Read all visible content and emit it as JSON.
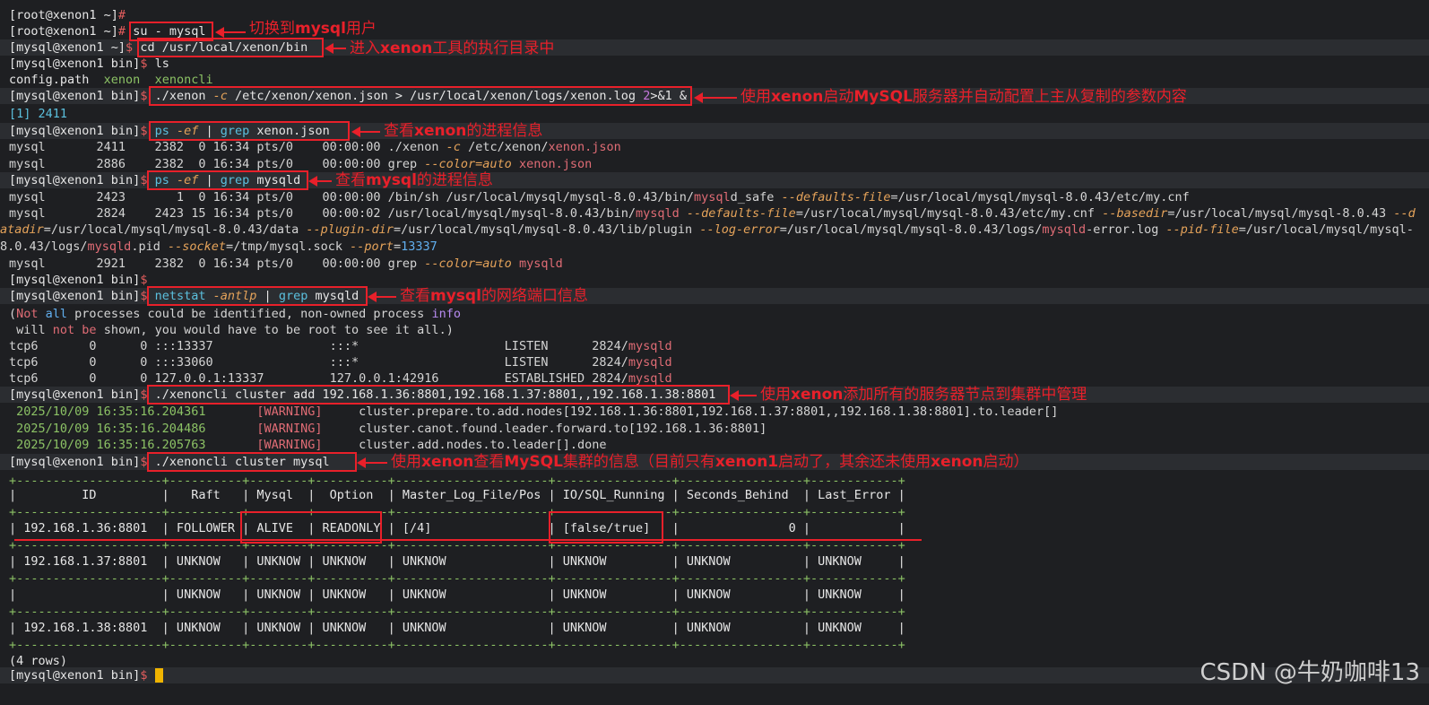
{
  "prompts": {
    "root": "[root@xenon1 ~]",
    "mysql_home": "[mysql@xenon1 ~]",
    "mysql_bin": "[mysql@xenon1 bin]",
    "root_sym": "#",
    "user_sym": "$"
  },
  "commands": {
    "su": "su - mysql",
    "cd": "cd /usr/local/xenon/bin",
    "ls": "ls",
    "ls_out_1": "config.path",
    "ls_out_2": "xenon",
    "ls_out_3": "xenoncli",
    "xenon_start_a": "./xenon",
    "xenon_start_b": "-c",
    "xenon_start_c": " /etc/xenon/xenon.json > /usr/local/xenon/logs/xenon.log ",
    "xenon_start_d": "2",
    "xenon_start_e": ">&1 &",
    "job": "[1] 2411",
    "ps_xenon_a": "ps",
    "ps_xenon_b": "-ef",
    "ps_xenon_c": " | ",
    "ps_xenon_d": "grep",
    "ps_xenon_e": " xenon.json",
    "ps_mysqld_e": " mysqld",
    "netstat_a": "netstat",
    "netstat_b": "-antlp",
    "cli_add_a": "./xenoncli cluster add ",
    "cli_add_b": "192.168.1.36:8801,192.168.1.37:8801,,192.168.1.38:8801",
    "cli_mysql": "./xenoncli cluster mysql"
  },
  "ps_rows": {
    "r1": "mysql       2411    2382  0 16:34 pts/0    00:00:00 ./xenon ",
    "r1b": "-c",
    "r1c": " /etc/xenon/",
    "r1d": "xenon.json",
    "r2": "mysql       2886    2382  0 16:34 pts/0    00:00:00 grep ",
    "r2b": "--color=auto",
    "r2c": " xenon.json",
    "m1": "mysql       2423       1  0 16:34 pts/0    00:00:00 /bin/sh /usr/local/mysql/mysql-8.0.43/bin/",
    "m1b": "mysql",
    "m1c": "d_safe ",
    "m1d": "--defaults-file",
    "m1e": "=/usr/local/mysql/mysql-8.0.43/etc/my.cnf",
    "m2": "mysql       2824    2423 15 16:34 pts/0    00:00:02 /usr/local/mysql/mysql-8.0.43/bin/",
    "m2b": "mysqld",
    "m2c": " --defaults-file",
    "m2d": "=/usr/local/mysql/mysql-8.0.43/etc/my.cnf ",
    "m2e": "--basedir",
    "m2f": "=/usr/local/mysql/mysql-8.0.43 ",
    "m2g": "--d",
    "m3a": "atadir",
    "m3b": "=/usr/local/mysql/mysql-8.0.43/data ",
    "m3c": "--plugin-dir",
    "m3d": "=/usr/local/mysql/mysql-8.0.43/lib/plugin ",
    "m3e": "--log-error",
    "m3f": "=/usr/local/mysql/mysql-8.0.43/logs/",
    "m3g": "mysqld",
    "m3h": "-error.log ",
    "m3i": "--pid-file",
    "m3j": "=/usr/local/mysql/mysql-",
    "m4a": "8.0.43/logs/",
    "m4b": "mysqld",
    "m4c": ".pid ",
    "m4d": "--socket",
    "m4e": "=/tmp/mysql.sock ",
    "m4f": "--port",
    "m4g": "=",
    "m4h": "13337",
    "m5": "mysql       2921    2382  0 16:34 pts/0    00:00:00 grep ",
    "m5b": "--color=auto",
    "m5c": " mysqld"
  },
  "netstat_out": {
    "w1a": "(",
    "w1b": "Not",
    "w1c": " all",
    "w1d": " processes could be identified, non-owned process ",
    "w1e": "info",
    "w2a": " will ",
    "w2b": "not be",
    "w2c": " shown, you would have to be root to see it all.)",
    "t1": "tcp6       0      0 :::13337                :::*                    LISTEN      2824/",
    "t2": "tcp6       0      0 :::33060                :::*                    LISTEN      2824/",
    "t3": "tcp6       0      0 127.0.0.1:13337         127.0.0.1:42916         ESTABLISHED 2824/",
    "proc": "mysqld"
  },
  "logs": [
    {
      "ts": " 2025/10/09 16:35:16.204361",
      "lvl": "[WARNING]",
      "msg": "cluster.prepare.to.add.nodes[192.168.1.36:8801,192.168.1.37:8801,,192.168.1.38:8801].to.leader[]"
    },
    {
      "ts": " 2025/10/09 16:35:16.204486",
      "lvl": "[WARNING]",
      "msg": "cluster.canot.found.leader.forward.to[192.168.1.36:8801]"
    },
    {
      "ts": " 2025/10/09 16:35:16.205763",
      "lvl": "[WARNING]",
      "msg": "cluster.add.nodes.to.leader[].done"
    }
  ],
  "table": {
    "border": "+--------------------+----------+--------+----------+---------------------+----------------+-----------------+------------+",
    "header": "|         ID         |   Raft   | Mysql  |  Option  | Master_Log_File/Pos | IO/SQL_Running | Seconds_Behind  | Last_Error |",
    "rows": [
      "| 192.168.1.36:8801  | FOLLOWER | ALIVE  | READONLY | [/4]                | [false/true]   |               0 |            |",
      "| 192.168.1.37:8801  | UNKNOW   | UNKNOW | UNKNOW   | UNKNOW              | UNKNOW         | UNKNOW          | UNKNOW     |",
      "|                    | UNKNOW   | UNKNOW | UNKNOW   | UNKNOW              | UNKNOW         | UNKNOW          | UNKNOW     |",
      "| 192.168.1.38:8801  | UNKNOW   | UNKNOW | UNKNOW   | UNKNOW              | UNKNOW         | UNKNOW          | UNKNOW     |"
    ],
    "count": "(4 rows)"
  },
  "notes": {
    "n1a": "切换到",
    "n1b": "mysql",
    "n1c": "用户",
    "n2a": "进入",
    "n2b": "xenon",
    "n2c": "工具的执行目录中",
    "n3a": "使用",
    "n3b": "xenon",
    "n3c": "启动",
    "n3d": "MySQL",
    "n3e": "服务器并自动配置上主从复制的参数内容",
    "n4a": "查看",
    "n4b": "xenon",
    "n4c": "的进程信息",
    "n5a": "查看",
    "n5b": "mysql",
    "n5c": "的进程信息",
    "n6a": "查看",
    "n6b": "mysql",
    "n6c": "的网络端口信息",
    "n7a": "使用",
    "n7b": "xenon",
    "n7c": "添加所有的服务器节点到集群中管理",
    "n8a": "使用",
    "n8b": "xenon",
    "n8c": "查看",
    "n8d": "MySQL",
    "n8e": "集群的信息（目前只有",
    "n8f": "xenon1",
    "n8g": "启动了，其余还未使用",
    "n8h": "xenon",
    "n8i": "启动）"
  },
  "watermark": "CSDN @牛奶咖啡13",
  "colors": {
    "annotation": "#e8202a",
    "background": "#1e1f22",
    "cursor": "#f0b400"
  }
}
